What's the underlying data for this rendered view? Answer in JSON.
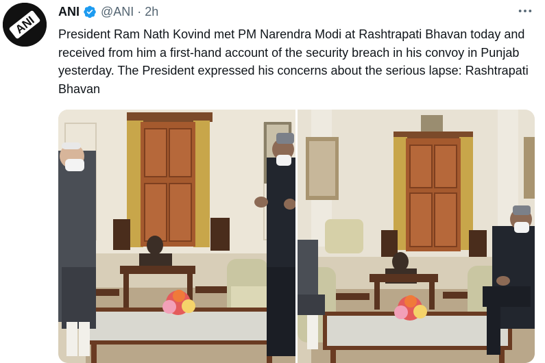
{
  "tweet": {
    "author_name": "ANI",
    "author_handle": "@ANI",
    "separator": "·",
    "timestamp": "2h",
    "avatar_text": "ANI",
    "verified": true,
    "text": "President Ram Nath Kovind met PM Narendra Modi at Rashtrapati Bhavan today and received from him a first-hand account of the security breach in his convoy in Punjab yesterday. The President expressed his concerns about the serious lapse: Rashtrapati Bhavan",
    "more_icon": "more-horizontal-icon",
    "badge_icon": "verified-badge-icon"
  },
  "colors": {
    "text": "#0f1419",
    "secondary": "#536471",
    "verified": "#1d9bf0"
  }
}
